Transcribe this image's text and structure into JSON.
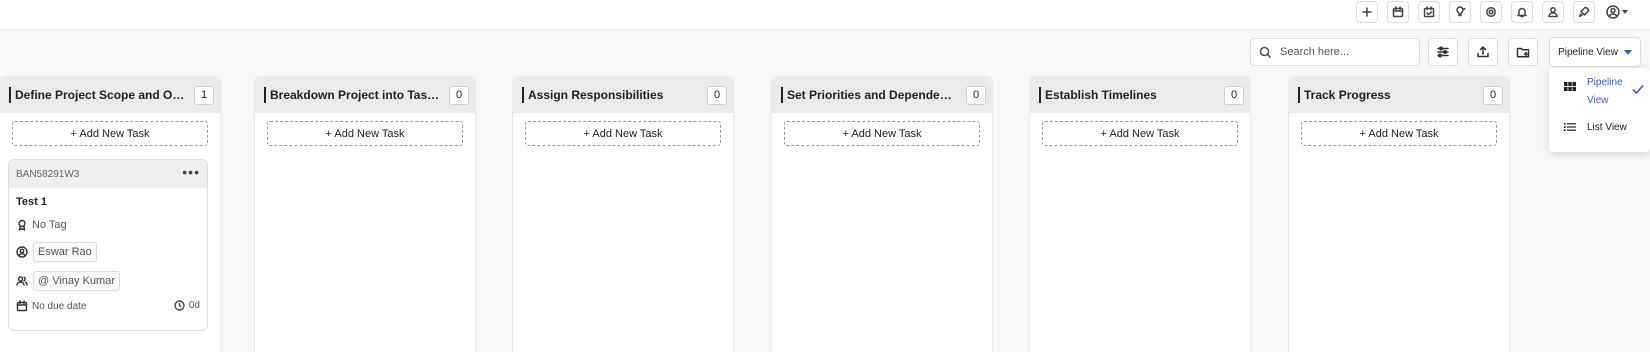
{
  "topbar": {
    "icons": [
      "plus-icon",
      "calendar-icon",
      "calendar-check-icon",
      "idea-icon",
      "settings-icon",
      "notification-icon",
      "profile-icon",
      "rocket-icon",
      "user-circle-icon"
    ]
  },
  "toolbar": {
    "search_placeholder": "Search here...",
    "view_label": "Pipeline View",
    "accent_color": "#3b5ccc"
  },
  "view_menu": {
    "options": [
      {
        "label": "Pipeline View",
        "selected": true,
        "icon": "grid-icon"
      },
      {
        "label": "List View",
        "selected": false,
        "icon": "list-icon"
      }
    ]
  },
  "board": {
    "add_task_label": "+ Add New Task",
    "columns": [
      {
        "title": "Define Project Scope and Objecti...",
        "count": "1"
      },
      {
        "title": "Breakdown Project into Tasks an...",
        "count": "0"
      },
      {
        "title": "Assign Responsibilities",
        "count": "0"
      },
      {
        "title": "Set Priorities and Dependencies",
        "count": "0"
      },
      {
        "title": "Establish Timelines",
        "count": "0"
      },
      {
        "title": "Track Progress",
        "count": "0"
      }
    ]
  },
  "card": {
    "code": "BAN58291W3",
    "more": "•••",
    "title": "Test 1",
    "tag": "No Tag",
    "owner": "Eswar Rao",
    "members": "@ Vinay Kumar",
    "due": "No due date",
    "age": "0d"
  }
}
